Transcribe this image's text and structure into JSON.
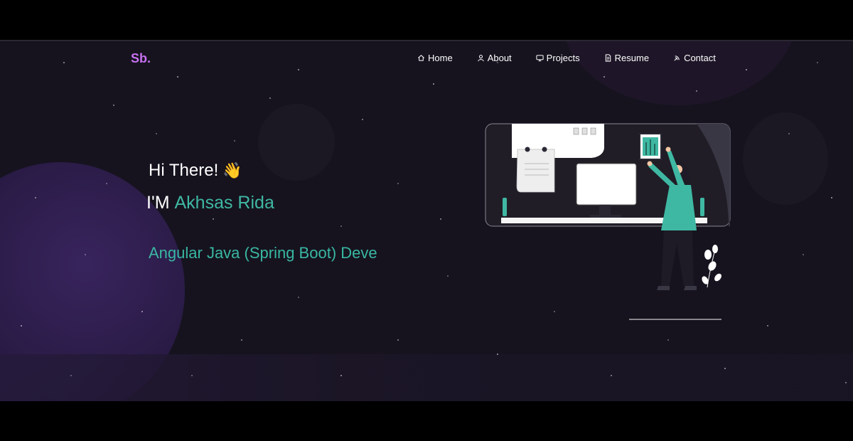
{
  "brand": {
    "logo": "Sb."
  },
  "nav": {
    "items": [
      {
        "label": "Home",
        "icon": "home-icon"
      },
      {
        "label": "About",
        "icon": "user-icon"
      },
      {
        "label": "Projects",
        "icon": "projects-icon"
      },
      {
        "label": "Resume",
        "icon": "document-icon"
      },
      {
        "label": "Contact",
        "icon": "contact-icon"
      }
    ]
  },
  "hero": {
    "greeting": "Hi There!",
    "wave_emoji": "👋",
    "intro_prefix": "I'M",
    "name": "Akhsas Rida",
    "typed_text": "Angular Java (Spring Boot) Deve"
  },
  "colors": {
    "accent_purple": "#c770f0",
    "accent_teal": "#3fb8a3",
    "background": "#16131f"
  }
}
